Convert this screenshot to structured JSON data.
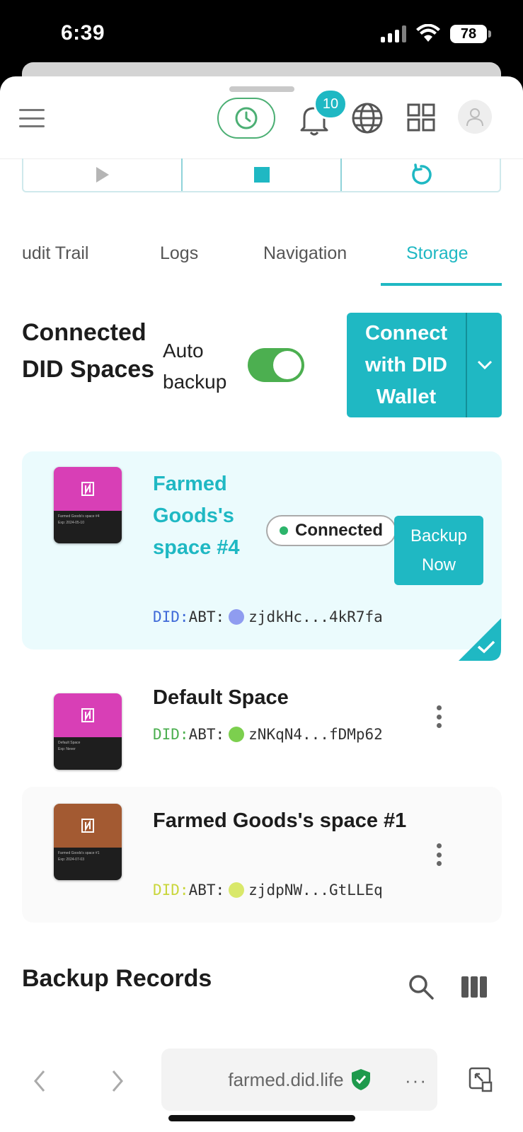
{
  "status_bar": {
    "time": "6:39",
    "battery": "78"
  },
  "header": {
    "notification_count": "10"
  },
  "tabs": [
    {
      "label": "udit Trail"
    },
    {
      "label": "Logs"
    },
    {
      "label": "Navigation"
    },
    {
      "label": "Storage",
      "active": true
    }
  ],
  "section": {
    "title": "Connected DID Spaces",
    "auto_backup_label": "Auto backup",
    "auto_backup_on": true,
    "connect_button": "Connect with DID Wallet"
  },
  "spaces": [
    {
      "name": "Farmed Goods's space #4",
      "did_prefix": "DID:",
      "did_type": "ABT:",
      "did_short": "zjdkHc...4kR7fa",
      "status": "Connected",
      "action": "Backup Now",
      "selected": true,
      "thumb_title": "Farmed Goods's space #4",
      "thumb_exp": "Exp: 2024-05-10",
      "thumb_color": "#d83fb6"
    },
    {
      "name": "Default Space",
      "did_prefix": "DID:",
      "did_type": "ABT:",
      "did_short": "zNKqN4...fDMp62",
      "thumb_title": "Default Space",
      "thumb_exp": "Exp: Never",
      "thumb_color": "#d83fb6"
    },
    {
      "name": "Farmed Goods's space #1",
      "did_prefix": "DID:",
      "did_type": "ABT:",
      "did_short": "zjdpNW...GtLLEq",
      "thumb_title": "Farmed Goods's space #1",
      "thumb_exp": "Exp: 2024-07-03",
      "thumb_color": "#a35a32"
    }
  ],
  "records": {
    "title": "Backup Records"
  },
  "browser": {
    "url": "farmed.did.life",
    "more": "···"
  },
  "colors": {
    "accent": "#1fb8c3",
    "toggle_on": "#4caf50",
    "connected_dot": "#2cb46b",
    "selected_card_bg": "#ebfbfd"
  },
  "icons": [
    "menu-icon",
    "clock-icon",
    "bell-icon",
    "globe-icon",
    "apps-grid-icon",
    "user-icon",
    "play-icon",
    "stop-icon",
    "restart-icon",
    "chevron-down-icon",
    "check-icon",
    "more-vertical-icon",
    "search-icon",
    "columns-icon",
    "back-arrow-icon",
    "forward-arrow-icon",
    "shield-check-icon",
    "resize-icon"
  ]
}
